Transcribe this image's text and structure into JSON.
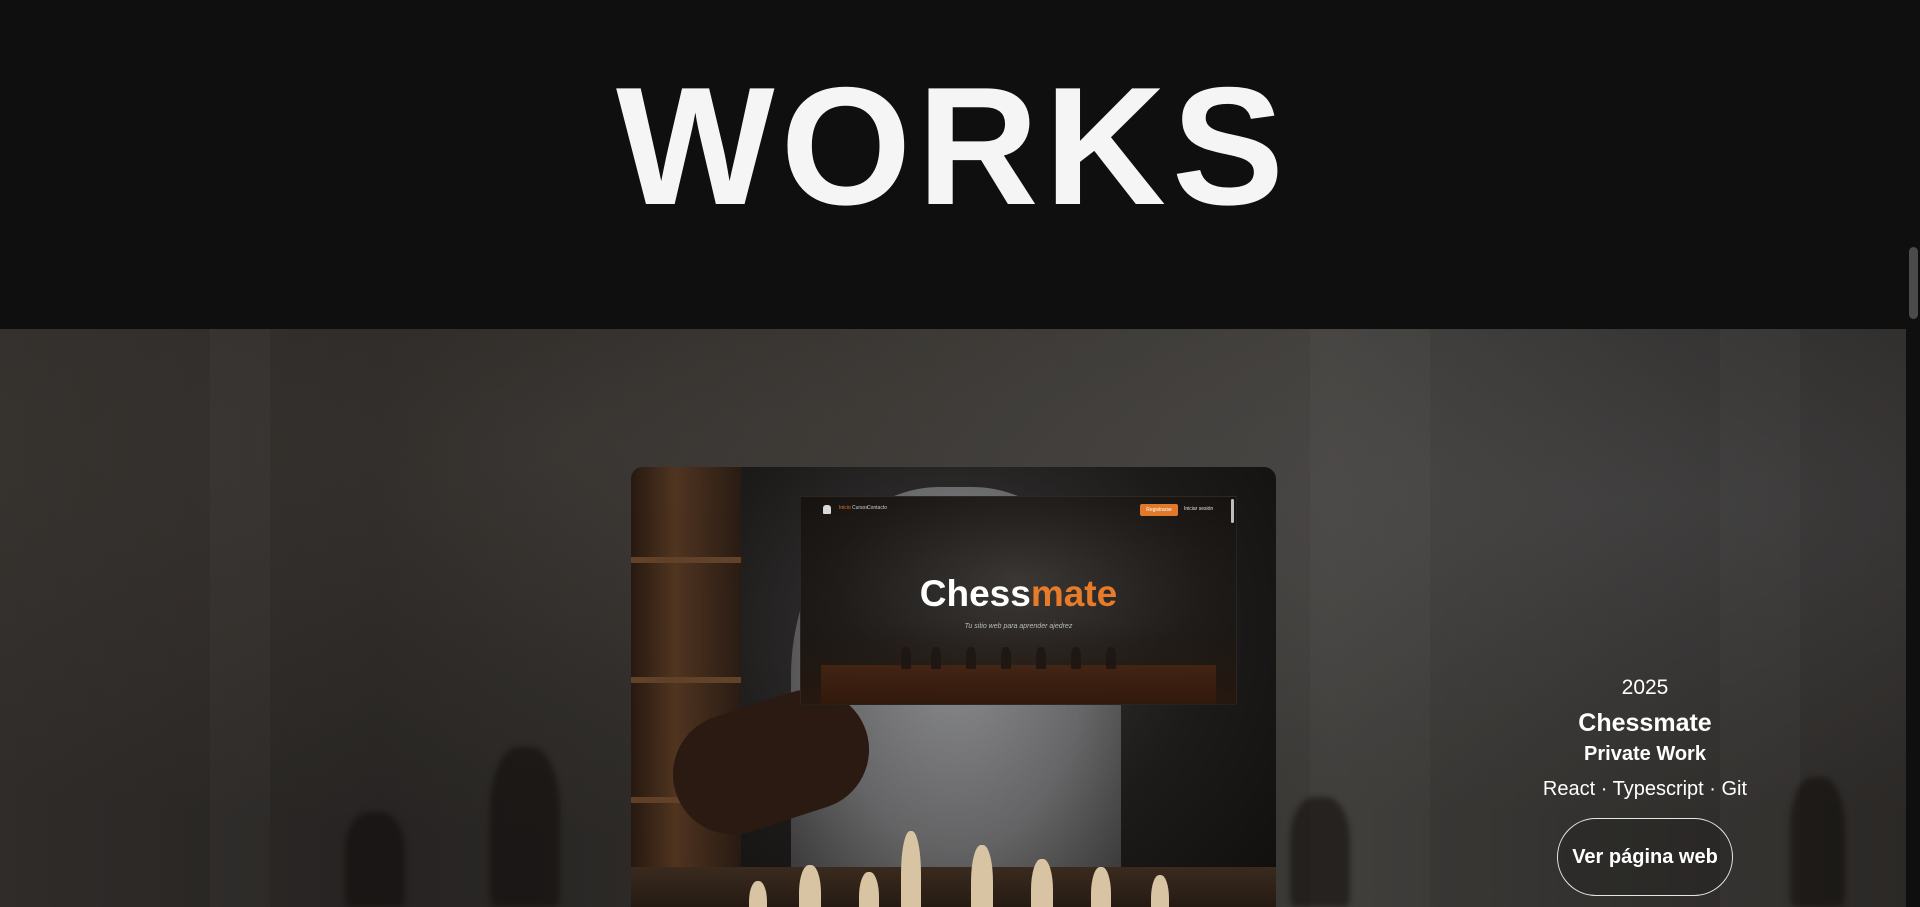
{
  "header": {
    "title": "WORKS"
  },
  "project": {
    "year": "2025",
    "name": "Chessmate",
    "kind": "Private Work",
    "stack": "React · Typescript · Git",
    "cta_label": "Ver página web",
    "preview": {
      "nav_links": [
        "Inicio",
        "Cursos",
        "Contacto"
      ],
      "register_label": "Registrarse",
      "login_label": "Iniciar sesión",
      "title_primary": "Chess",
      "title_accent": "mate",
      "subtitle": "Tu sitio web para aprender ajedrez"
    }
  },
  "colors": {
    "background": "#0f0f0f",
    "title": "#f5f5f5",
    "accent_orange": "#e67c2a",
    "button_border": "#e6e6e6"
  }
}
